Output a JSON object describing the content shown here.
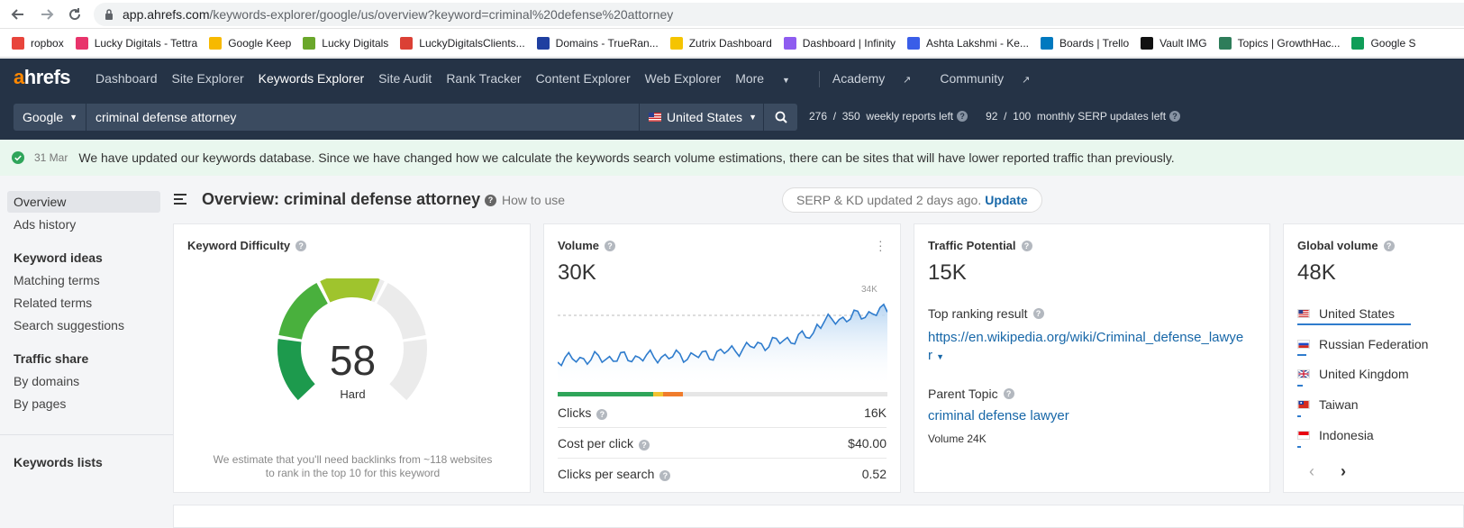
{
  "browser": {
    "url_host": "app.ahrefs.com",
    "url_path": "/keywords-explorer/google/us/overview?keyword=criminal%20defense%20attorney",
    "bookmarks": [
      {
        "label": "ropbox",
        "color": "#e8453c"
      },
      {
        "label": "Lucky Digitals - Tettra",
        "color": "#e8346b"
      },
      {
        "label": "Google Keep",
        "color": "#f7b900"
      },
      {
        "label": "Lucky Digitals",
        "color": "#6aa72b"
      },
      {
        "label": "LuckyDigitalsClients...",
        "color": "#db4035"
      },
      {
        "label": "Domains - TrueRan...",
        "color": "#1f3fa0"
      },
      {
        "label": "Zutrix Dashboard",
        "color": "#f5c400"
      },
      {
        "label": "Dashboard | Infinity",
        "color": "#8e5cf0"
      },
      {
        "label": "Ashta Lakshmi - Ke...",
        "color": "#3a5ee8"
      },
      {
        "label": "Boards | Trello",
        "color": "#0079bf"
      },
      {
        "label": "Vault IMG",
        "color": "#111111"
      },
      {
        "label": "Topics | GrowthHac...",
        "color": "#2e7d5a"
      },
      {
        "label": "Google S",
        "color": "#0f9d58"
      }
    ]
  },
  "header": {
    "logo_a": "a",
    "logo_rest": "hrefs",
    "menu": [
      "Dashboard",
      "Site Explorer",
      "Keywords Explorer",
      "Site Audit",
      "Rank Tracker",
      "Content Explorer",
      "Web Explorer",
      "More"
    ],
    "active_menu": "Keywords Explorer",
    "academy": "Academy",
    "community": "Community"
  },
  "search": {
    "engine": "Google",
    "keyword": "criminal defense attorney",
    "country": "United States",
    "weekly_used": "276",
    "weekly_total": "350",
    "weekly_label": "weekly reports left",
    "serp_used": "92",
    "serp_total": "100",
    "serp_label": "monthly SERP updates left"
  },
  "notice": {
    "date": "31 Mar",
    "text": "We have updated our keywords database. Since we have changed how we calculate the keywords search volume estimations, there can be sites that will have lower reported traffic than previously."
  },
  "sidebar": {
    "overview": "Overview",
    "ads_history": "Ads history",
    "keyword_ideas": "Keyword ideas",
    "matching_terms": "Matching terms",
    "related_terms": "Related terms",
    "search_suggestions": "Search suggestions",
    "traffic_share": "Traffic share",
    "by_domains": "By domains",
    "by_pages": "By pages",
    "keywords_lists": "Keywords lists"
  },
  "page": {
    "title": "Overview: criminal defense attorney",
    "how_to_use": "How to use",
    "serp_status": "SERP & KD updated 2 days ago.",
    "update": "Update"
  },
  "kd": {
    "title": "Keyword Difficulty",
    "value": "58",
    "level": "Hard",
    "note_line1": "We estimate that you'll need backlinks from ~118 websites",
    "note_line2": "to rank in the top 10 for this keyword"
  },
  "volume": {
    "title": "Volume",
    "value": "30K",
    "max_label": "34K",
    "clicks_label": "Clicks",
    "clicks_value": "16K",
    "cpc_label": "Cost per click",
    "cpc_value": "$40.00",
    "cps_label": "Clicks per search",
    "cps_value": "0.52",
    "click_bar": {
      "organic": 0.29,
      "paid": 0.03,
      "paid2": 0.06
    }
  },
  "traffic": {
    "title": "Traffic Potential",
    "value": "15K",
    "top_label": "Top ranking result",
    "top_url_line1": "https://en.wikipedia.org/wiki/Criminal_defense_lawye",
    "top_url_line2": "r",
    "parent_label": "Parent Topic",
    "parent_value": "criminal defense lawyer",
    "parent_volume": "Volume 24K"
  },
  "global": {
    "title": "Global volume",
    "value": "48K",
    "countries": [
      {
        "name": "United States",
        "share": 0.63
      },
      {
        "name": "Russian Federation",
        "share": 0.05
      },
      {
        "name": "United Kingdom",
        "share": 0.03
      },
      {
        "name": "Taiwan",
        "share": 0.02
      },
      {
        "name": "Indonesia",
        "share": 0.02
      }
    ]
  },
  "colors": {
    "nav_bg": "#253346",
    "accent": "#ff8800",
    "link": "#1767a8",
    "chart_line": "#2f7ccd"
  }
}
